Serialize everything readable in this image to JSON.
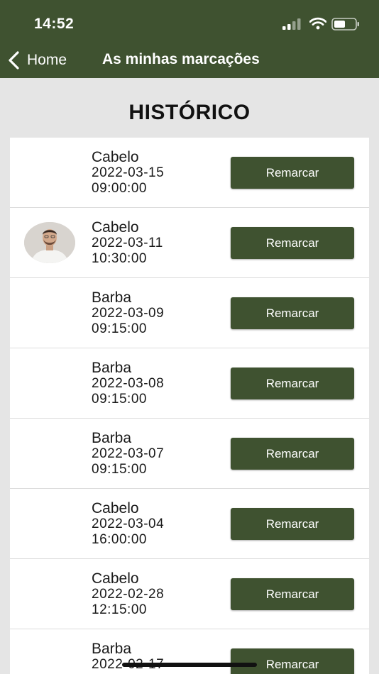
{
  "status_bar": {
    "time": "14:52"
  },
  "nav": {
    "back_label": "Home",
    "title": "As minhas marcações"
  },
  "section_title": "HISTÓRICO",
  "button_label": "Remarcar",
  "appointments": [
    {
      "service": "Cabelo",
      "date": "2022-03-15",
      "time": "09:00:00",
      "avatar": false
    },
    {
      "service": "Cabelo",
      "date": "2022-03-11",
      "time": "10:30:00",
      "avatar": true
    },
    {
      "service": "Barba",
      "date": "2022-03-09",
      "time": "09:15:00",
      "avatar": false
    },
    {
      "service": "Barba",
      "date": "2022-03-08",
      "time": "09:15:00",
      "avatar": false
    },
    {
      "service": "Barba",
      "date": "2022-03-07",
      "time": "09:15:00",
      "avatar": false
    },
    {
      "service": "Cabelo",
      "date": "2022-03-04",
      "time": "16:00:00",
      "avatar": false
    },
    {
      "service": "Cabelo",
      "date": "2022-02-28",
      "time": "12:15:00",
      "avatar": false
    },
    {
      "service": "Barba",
      "date": "2022-02-17",
      "time": "",
      "avatar": false
    }
  ],
  "colors": {
    "accent": "#3f5230",
    "background": "#e5e5e5"
  }
}
